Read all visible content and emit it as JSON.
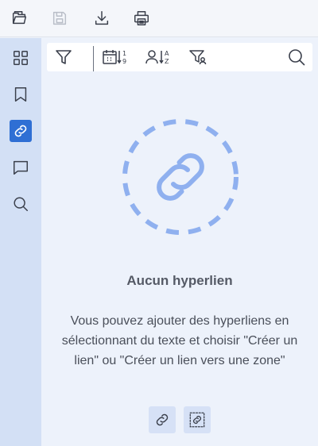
{
  "toolbar": {
    "items": [
      {
        "name": "open-file",
        "icon": "folder-open-icon",
        "enabled": true
      },
      {
        "name": "save",
        "icon": "save-icon",
        "enabled": false
      },
      {
        "name": "download",
        "icon": "download-icon",
        "enabled": true
      },
      {
        "name": "print",
        "icon": "printer-icon",
        "enabled": true
      }
    ]
  },
  "sidebar": {
    "items": [
      {
        "name": "thumbnails",
        "icon": "grid-icon",
        "active": false
      },
      {
        "name": "bookmarks",
        "icon": "bookmark-icon",
        "active": false
      },
      {
        "name": "hyperlinks",
        "icon": "link-icon",
        "active": true
      },
      {
        "name": "comments",
        "icon": "comment-icon",
        "active": false
      },
      {
        "name": "search",
        "icon": "search-icon",
        "active": false
      }
    ]
  },
  "filterbar": {
    "items": [
      {
        "name": "filter",
        "icon": "filter-icon"
      },
      {
        "name": "sort-by-date",
        "icon": "calendar-sort-icon"
      },
      {
        "name": "sort-by-author",
        "icon": "user-sort-az-icon"
      },
      {
        "name": "filter-by-author",
        "icon": "filter-user-icon"
      },
      {
        "name": "search",
        "icon": "search-icon"
      }
    ]
  },
  "empty_state": {
    "title": "Aucun hyperlien",
    "description": "Vous pouvez ajouter des hyperliens en sélectionnant du texte et choisir \"Créer un lien\" ou \"Créer un lien vers une zone\""
  },
  "actions": [
    {
      "name": "create-link",
      "icon": "link-icon"
    },
    {
      "name": "create-link-area",
      "icon": "link-area-icon"
    }
  ],
  "colors": {
    "accent": "#2f6fd4",
    "illustration": "#8fb0ef",
    "sidebar_bg": "#d3e0f5",
    "panel_bg": "#edf2fb"
  }
}
